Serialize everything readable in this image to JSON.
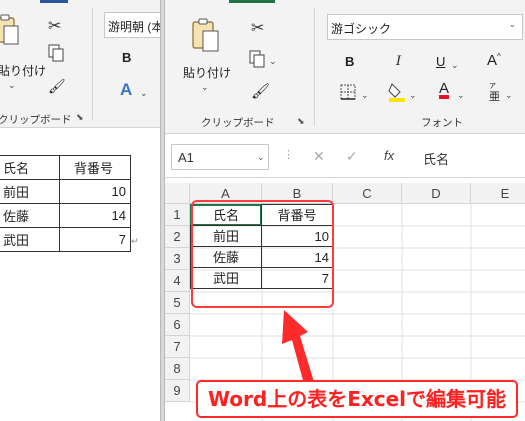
{
  "word": {
    "clipboard": {
      "paste_label": "貼り付け",
      "group_label": "クリップボード"
    },
    "font": {
      "font_name": "游明朝 (本",
      "bold_label": "B",
      "text_effect_label": "A"
    },
    "table": {
      "header": [
        "氏名",
        "背番号"
      ],
      "rows": [
        [
          "前田",
          "10"
        ],
        [
          "佐藤",
          "14"
        ],
        [
          "武田",
          "7"
        ]
      ]
    }
  },
  "excel": {
    "clipboard": {
      "paste_label": "貼り付け",
      "group_label": "クリップボード"
    },
    "font": {
      "font_name": "游ゴシック",
      "bold_label": "B",
      "italic_label": "I",
      "underline_label": "U",
      "grow_label": "A",
      "font_color_label": "A",
      "phonetic_label": "亜",
      "group_label": "フォント"
    },
    "formula_bar": {
      "name_box": "A1",
      "fx_label": "fx",
      "content": "氏名"
    },
    "columns": [
      "A",
      "B",
      "C",
      "D",
      "E"
    ],
    "rows": [
      "1",
      "2",
      "3",
      "4",
      "5",
      "6",
      "7",
      "8",
      "9"
    ],
    "cells": {
      "A1": "氏名",
      "B1": "背番号",
      "A2": "前田",
      "B2": "10",
      "A3": "佐藤",
      "B3": "14",
      "A4": "武田",
      "B4": "7"
    }
  },
  "callout": {
    "text": "Word上の表をExcelで編集可能"
  },
  "colors": {
    "annotation_red": "#ff2a2a",
    "excel_green": "#217346",
    "word_blue": "#2b579a",
    "highlight_yellow": "#ffe600",
    "font_color_red": "#e81123"
  }
}
